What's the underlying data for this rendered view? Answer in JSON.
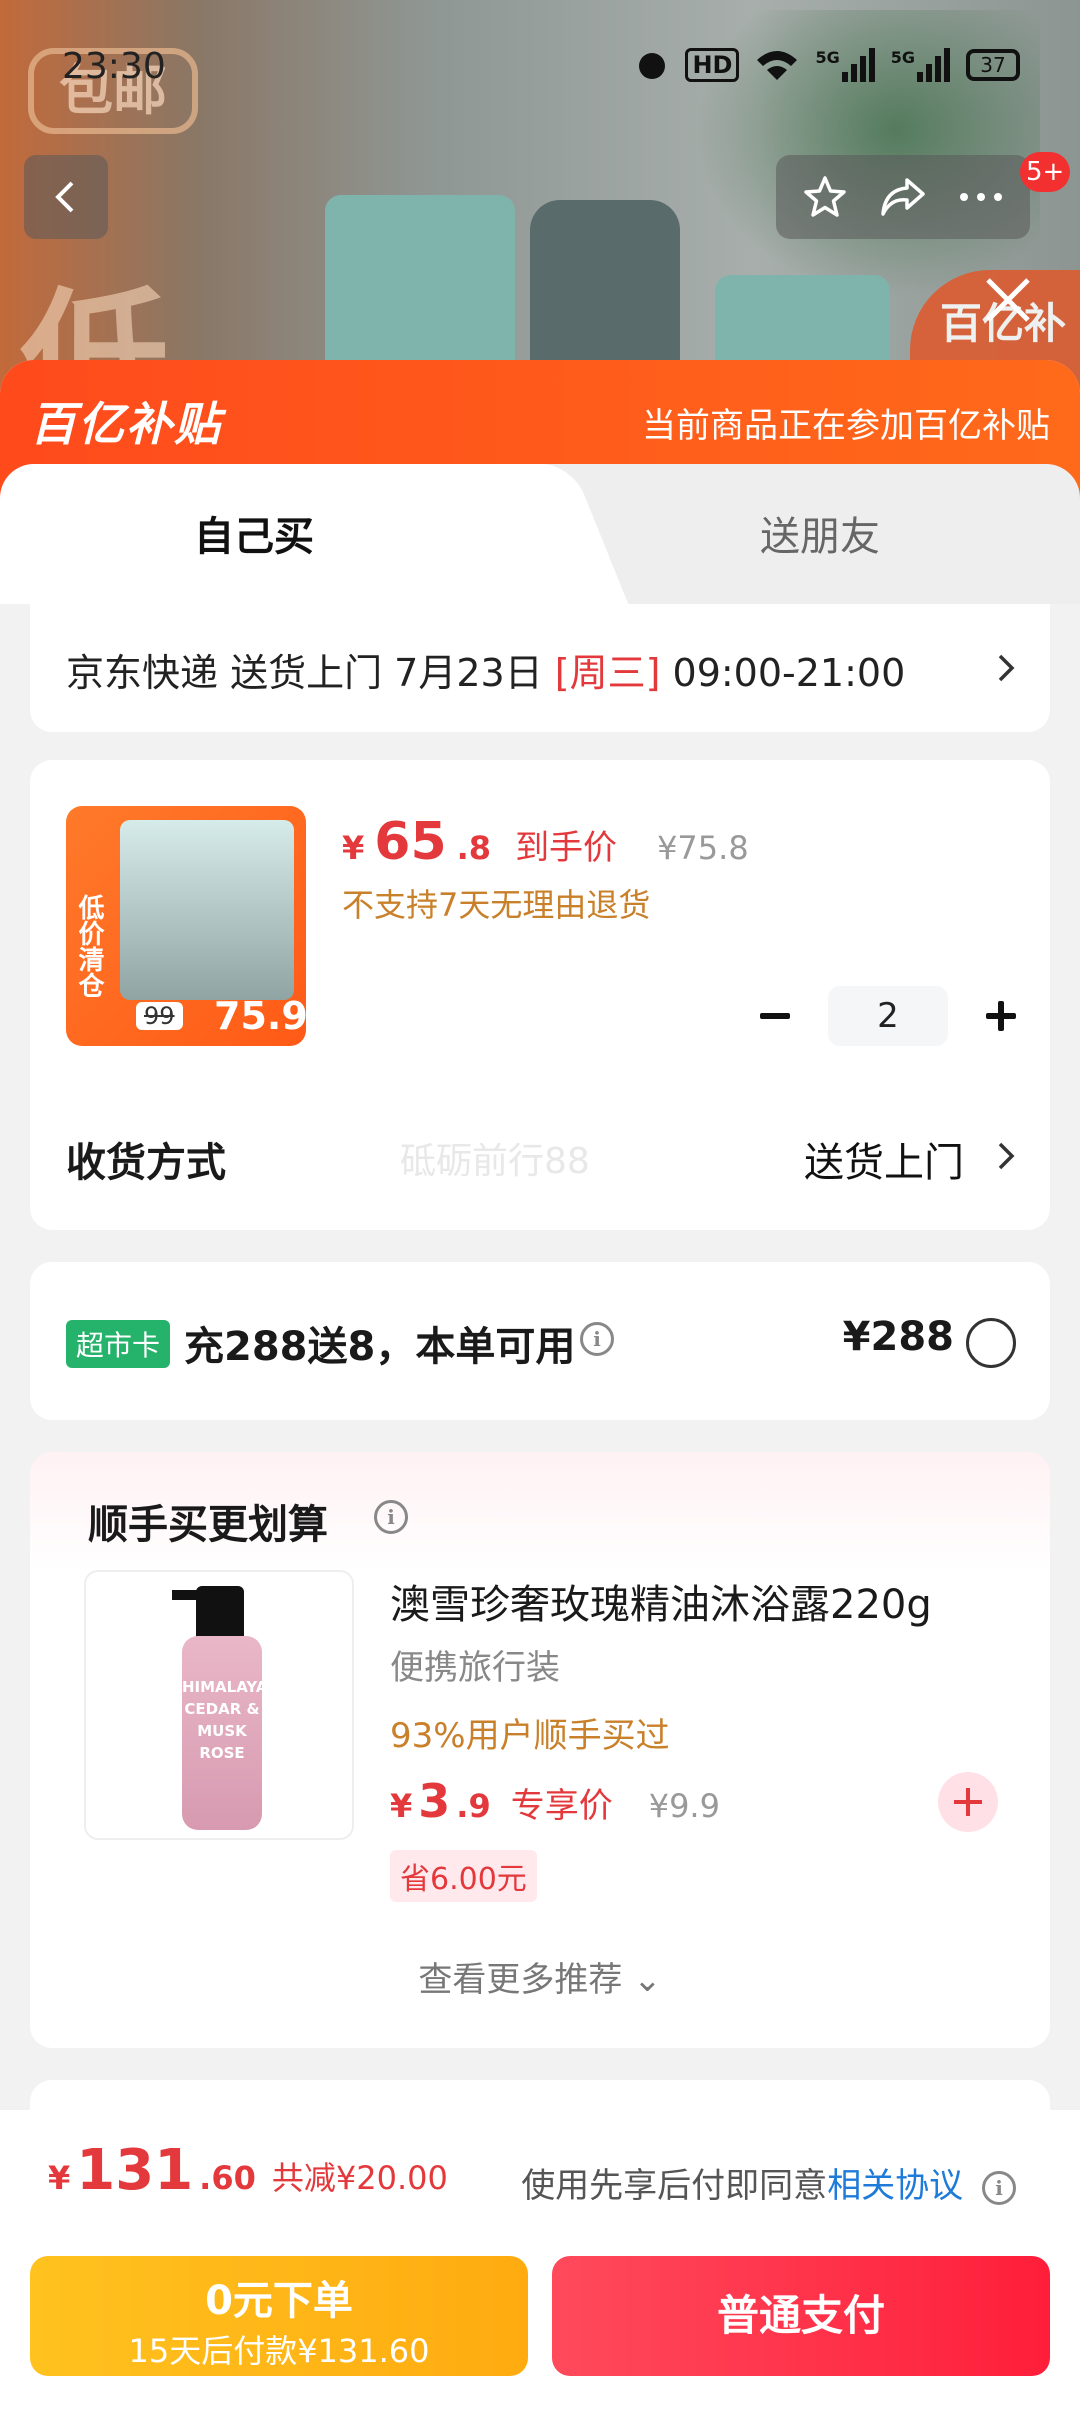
{
  "status_bar": {
    "time": "23:30",
    "network": "HD",
    "signal_1": "5G",
    "signal_2": "5G",
    "battery": "37"
  },
  "background": {
    "badge": "包邮",
    "big_text": "低",
    "sub_badge": "百亿补贴"
  },
  "header": {
    "notification_count": "5+"
  },
  "subsidy": {
    "logo": "百亿补贴",
    "note": "当前商品正在参加百亿补贴"
  },
  "tabs": [
    {
      "label": "自己买"
    },
    {
      "label": "送朋友"
    }
  ],
  "delivery": {
    "prefix": "京东快递 送货上门 7月23日 ",
    "weekday": "[周三]",
    "window": " 09:00-21:00"
  },
  "product": {
    "thumb": {
      "side_text": "低价清仓",
      "old_price": "99",
      "new_price": "75.9"
    },
    "price_symbol": "¥",
    "price_int": "65",
    "price_dec": ".8",
    "price_label": "到手价",
    "original_price": "¥75.8",
    "return_policy": "不支持7天无理由退货",
    "quantity": "2",
    "shipping_label": "收货方式",
    "watermark": "砥砺前行88",
    "shipping_value": "送货上门"
  },
  "market_card": {
    "tag": "超市卡",
    "text": "充288送8，本单可用",
    "price": "¥288"
  },
  "recommend": {
    "title": "顺手买更划算",
    "image_text": "HIMALAYA CEDAR & MUSK ROSE",
    "name": "澳雪珍奢玫瑰精油沐浴露220g",
    "sub": "便携旅行装",
    "popularity": "93%用户顺手买过",
    "price_symbol": "¥",
    "price_int": "3",
    "price_dec": ".9",
    "price_label": "专享价",
    "original_price": "¥9.9",
    "save": "省6.00元",
    "more": "查看更多推荐 ⌄"
  },
  "footer": {
    "price_symbol": "¥",
    "total_int": "131",
    "total_dec": ".60",
    "discount": "共减¥20.00",
    "agree_text": "使用先享后付即同意",
    "agree_link": "相关协议",
    "btn_later_line1": "0元下单",
    "btn_later_line2": "15天后付款¥131.60",
    "btn_pay": "普通支付"
  },
  "colors": {
    "accent": "#e4393c",
    "subsidy": "#ff4a1c",
    "pay": "#ff1e3a",
    "later": "#ffb415",
    "market_tag": "#25b26a"
  }
}
